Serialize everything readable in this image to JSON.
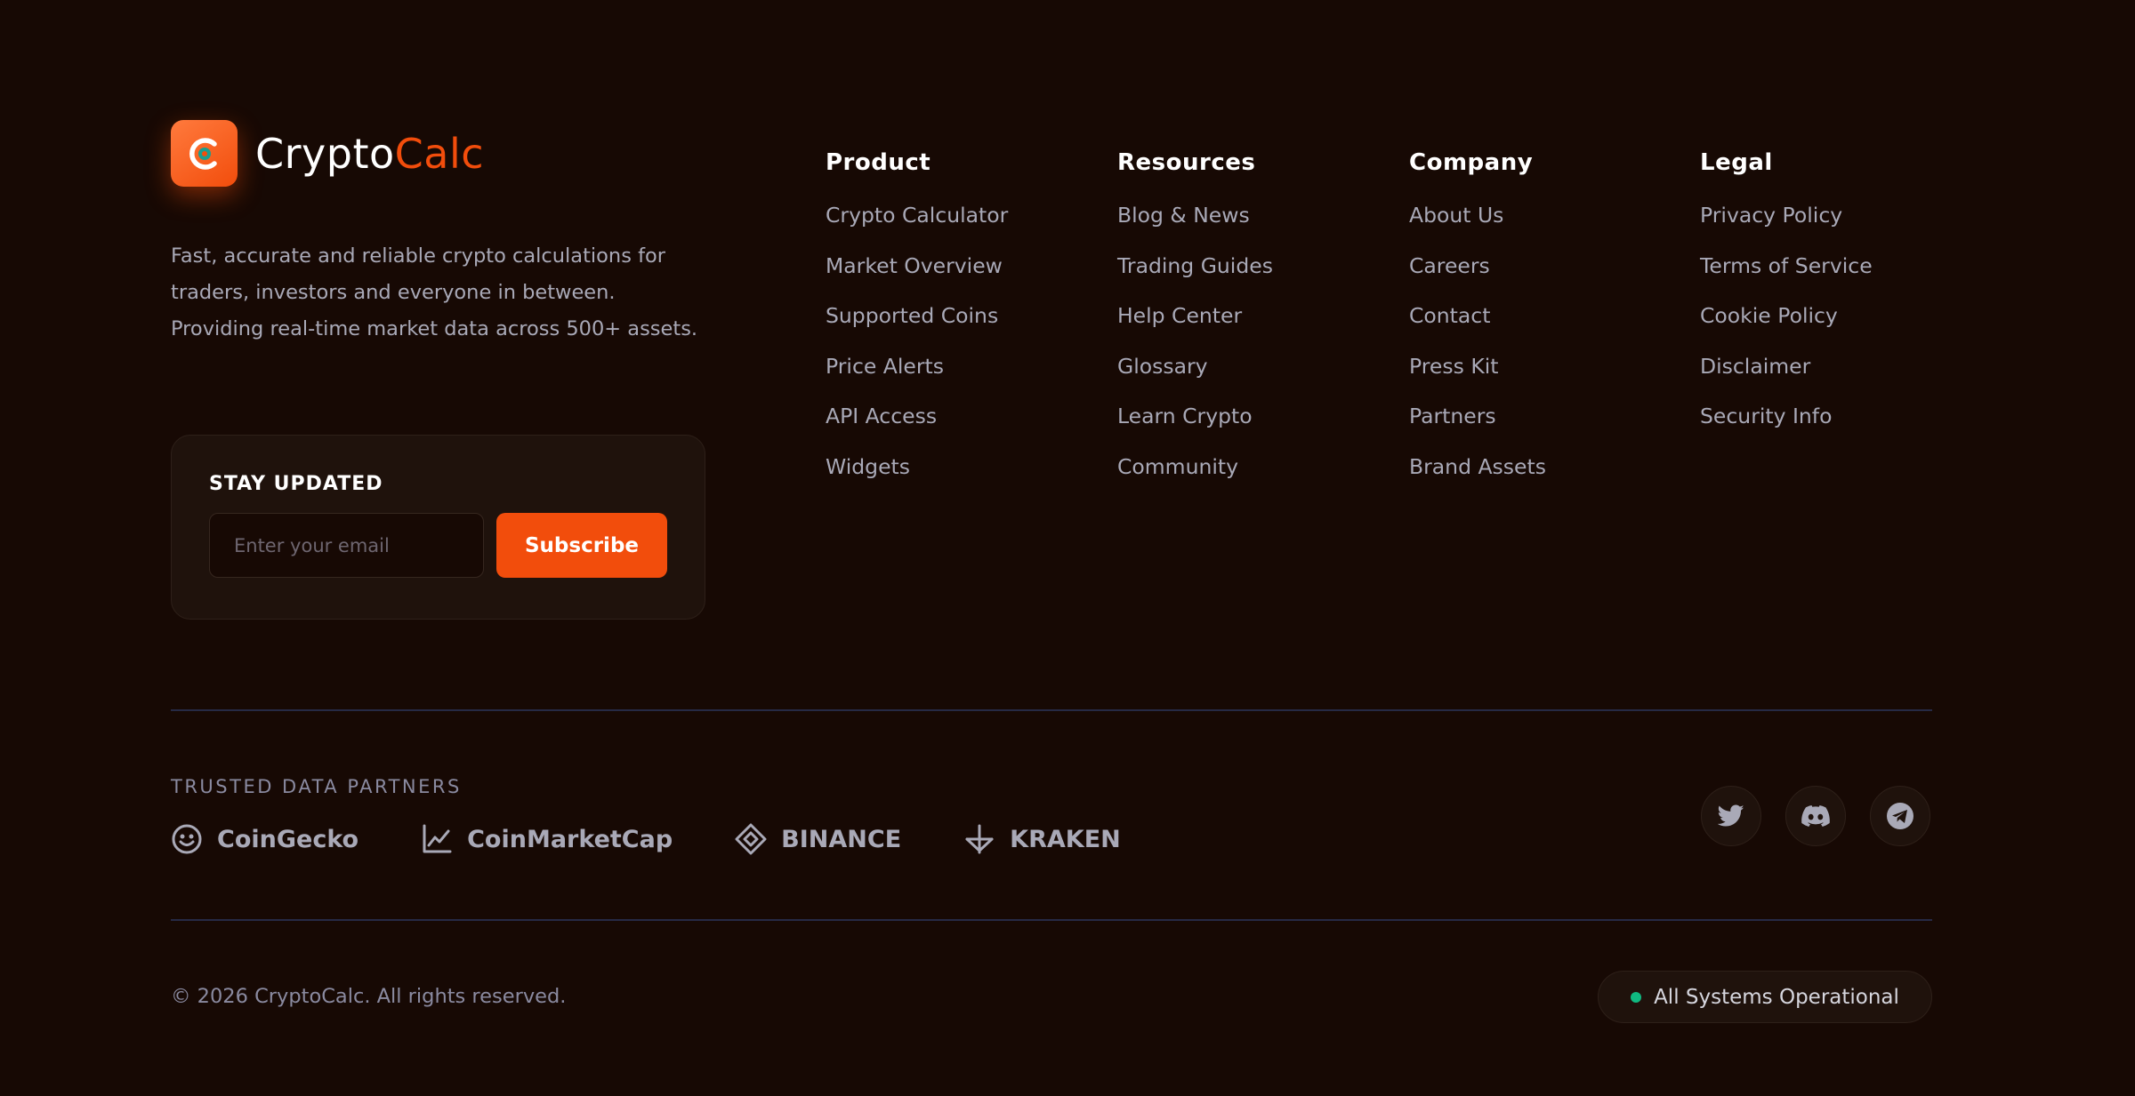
{
  "brand": {
    "name_primary": "Crypto",
    "name_accent": "Calc",
    "description": "Fast, accurate and reliable crypto calculations for traders, investors and everyone in between. Providing real-time market data across 500+ assets."
  },
  "newsletter": {
    "title": "STAY UPDATED",
    "email_placeholder": "Enter your email",
    "email_value": "",
    "subscribe_label": "Subscribe"
  },
  "columns": [
    {
      "heading": "Product",
      "links": [
        "Crypto Calculator",
        "Market Overview",
        "Supported Coins",
        "Price Alerts",
        "API Access",
        "Widgets"
      ]
    },
    {
      "heading": "Resources",
      "links": [
        "Blog & News",
        "Trading Guides",
        "Help Center",
        "Glossary",
        "Learn Crypto",
        "Community"
      ]
    },
    {
      "heading": "Company",
      "links": [
        "About Us",
        "Careers",
        "Contact",
        "Press Kit",
        "Partners",
        "Brand Assets"
      ]
    },
    {
      "heading": "Legal",
      "links": [
        "Privacy Policy",
        "Terms of Service",
        "Cookie Policy",
        "Disclaimer",
        "Security Info"
      ]
    }
  ],
  "partners": {
    "label": "TRUSTED DATA PARTNERS",
    "items": [
      {
        "name": "CoinGecko",
        "icon": "coingecko-icon"
      },
      {
        "name": "CoinMarketCap",
        "icon": "chart-line-icon"
      },
      {
        "name": "BINANCE",
        "icon": "binance-diamond-icon"
      },
      {
        "name": "KRAKEN",
        "icon": "kraken-arrow-icon"
      }
    ]
  },
  "social": [
    {
      "icon": "twitter-icon"
    },
    {
      "icon": "discord-icon"
    },
    {
      "icon": "telegram-icon"
    }
  ],
  "bottom": {
    "copyright": "© 2026 CryptoCalc. All rights reserved.",
    "status": "All Systems Operational"
  },
  "colors": {
    "background": "#170904",
    "accent": "#f24d0c",
    "status_ok": "#10b981",
    "divider": "#262a45"
  }
}
